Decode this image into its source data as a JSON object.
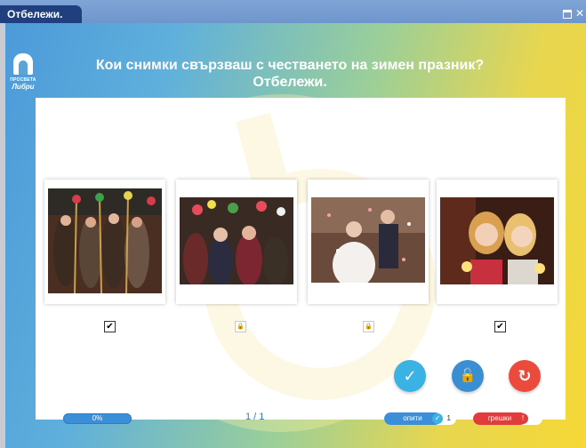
{
  "window": {
    "title": "Отбележи.",
    "maximize_icon": "window-maximize-icon",
    "close_icon": "close-icon"
  },
  "logo": {
    "line1": "ПРОСВЕТА",
    "line2": "Либри"
  },
  "question": {
    "line1": "Кои снимки свързваш с честването на зимен празник?",
    "line2": "Отбележи."
  },
  "cards": [
    {
      "photo": "carolers-in-costumes-with-decorated-sticks",
      "checked": true,
      "locked": false,
      "mark": "✔"
    },
    {
      "photo": "children-with-decorated-survachki-branches",
      "checked": false,
      "locked": true,
      "mark": "🔒"
    },
    {
      "photo": "wedding-couple-with-confetti",
      "checked": false,
      "locked": true,
      "mark": "🔒"
    },
    {
      "photo": "girls-with-sparklers-by-fireplace",
      "checked": true,
      "locked": false,
      "mark": "✔"
    }
  ],
  "actions": {
    "check_icon": "check-icon",
    "lock_icon": "lock-icon",
    "reset_icon": "reset-icon",
    "check_glyph": "✓",
    "lock_glyph": "🔓",
    "reset_glyph": "↻"
  },
  "footer": {
    "progress_label": "0%",
    "progress_value": 0,
    "pager": "1 / 1",
    "attempts_label": "опити",
    "attempts_count": "1",
    "errors_label": "грешки",
    "errors_count": ""
  },
  "colors": {
    "accent_blue": "#3a8fd8",
    "check_button": "#3bb2e4",
    "reset_button": "#ec4a3d",
    "errors_red": "#e23b3b",
    "title_tab": "#1f3f7f"
  }
}
